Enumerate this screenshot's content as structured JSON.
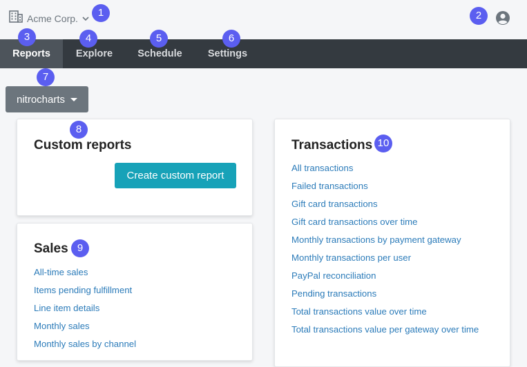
{
  "header": {
    "org_name": "Acme Corp.",
    "org_icon": "building-icon",
    "user_icon": "user-circle-icon"
  },
  "nav": {
    "tabs": [
      {
        "label": "Reports",
        "active": true
      },
      {
        "label": "Explore",
        "active": false
      },
      {
        "label": "Schedule",
        "active": false
      },
      {
        "label": "Settings",
        "active": false
      }
    ]
  },
  "dropdown": {
    "selected": "nitrocharts"
  },
  "custom_reports": {
    "title": "Custom reports",
    "button_label": "Create custom report"
  },
  "sales": {
    "title": "Sales",
    "links": [
      "All-time sales",
      "Items pending fulfillment",
      "Line item details",
      "Monthly sales",
      "Monthly sales by channel"
    ]
  },
  "transactions": {
    "title": "Transactions",
    "links": [
      "All transactions",
      "Failed transactions",
      "Gift card transactions",
      "Gift card transactions over time",
      "Monthly transactions by payment gateway",
      "Monthly transactions per user",
      "PayPal reconciliation",
      "Pending transactions",
      "Total transactions value over time",
      "Total transactions value per gateway over time"
    ]
  },
  "annotations": [
    "1",
    "2",
    "3",
    "4",
    "5",
    "6",
    "7",
    "8",
    "9",
    "10"
  ],
  "colors": {
    "nav_bg": "#343a40",
    "nav_active": "#4d545b",
    "accent_teal": "#17a2b8",
    "link": "#2b7bb9",
    "badge": "#5b5ef0"
  }
}
